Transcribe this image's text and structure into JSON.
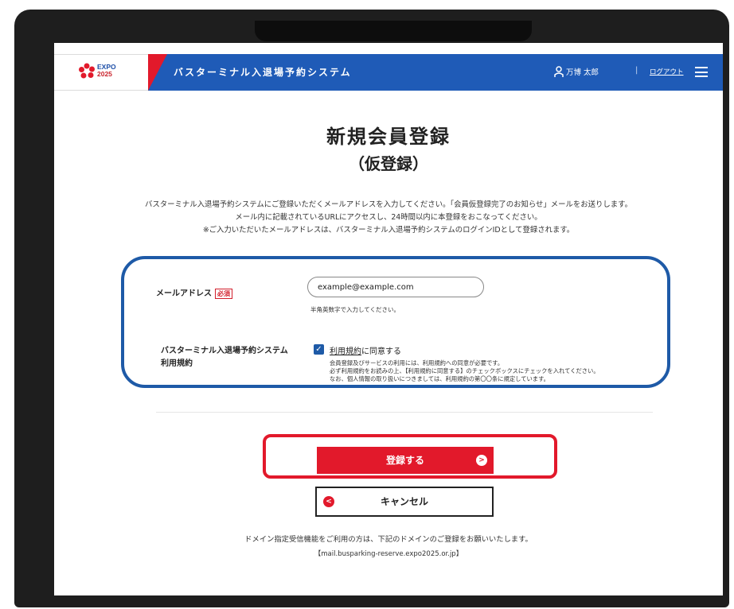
{
  "header": {
    "logo_text": [
      "EXPO",
      "2025"
    ],
    "system_title": "バスターミナル入退場予約システム",
    "user_name": "万博 太郎",
    "separator": "|",
    "logout": "ログアウト"
  },
  "page": {
    "title": "新規会員登録",
    "subtitle": "（仮登録）",
    "intro": [
      "バスターミナル入退場予約システムにご登録いただくメールアドレスを入力してください。「会員仮登録完了のお知らせ」メールをお送りします。",
      "メール内に記載されているURLにアクセスし、24時間以内に本登録をおこなってください。",
      "※ご入力いただいたメールアドレスは、バスターミナル入退場予約システムのログインIDとして登録されます。"
    ]
  },
  "form": {
    "email_label": "メールアドレス",
    "required_badge": "必須",
    "email_value": "example@example.com",
    "email_hint": "半角英数字で入力してください。",
    "terms_label": [
      "バスターミナル入退場予約システム",
      "利用規約"
    ],
    "terms_checked": true,
    "agree_link": "利用規約",
    "agree_text": "に同意する",
    "terms_notes": [
      "会員登録及びサービスの利用には、利用規約への同意が必要です。",
      "必ず利用規約をお読みの上、【利用規約に同意する】のチェックボックスにチェックを入れてください。",
      "なお、個人情報の取り扱いにつきましては、利用規約の第〇〇条に規定しています。"
    ]
  },
  "actions": {
    "register": "登録する",
    "cancel": "キャンセル"
  },
  "footer": {
    "domain_note": "ドメイン指定受信機能をご利用の方は、下記のドメインのご登録をお願いいたします。",
    "domain": "【mail.busparking-reserve.expo2025.or.jp】"
  },
  "colors": {
    "header_blue": "#1f5bb7",
    "accent_red": "#e2192b",
    "form_outline_blue": "#1e5aa7"
  }
}
